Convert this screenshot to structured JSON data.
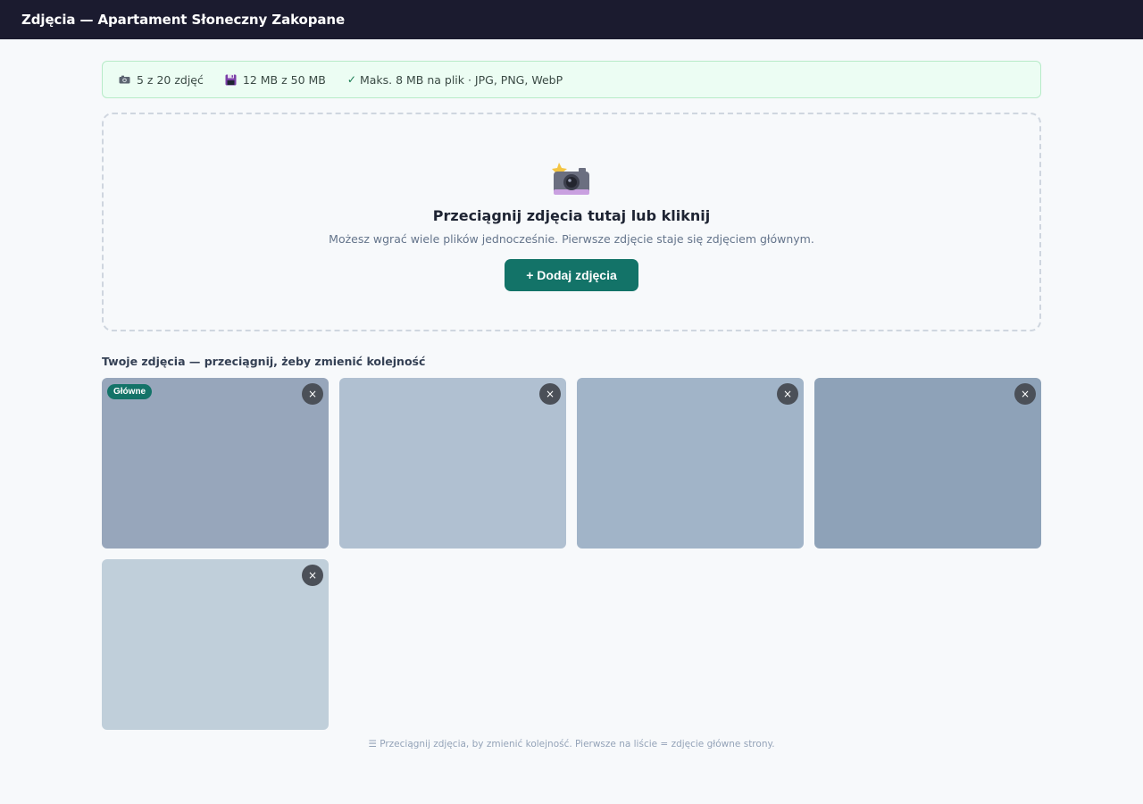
{
  "header": {
    "title": "Zdjęcia — Apartament Słoneczny Zakopane"
  },
  "info_bar": {
    "photos_count": "5 z 20 zdjęć",
    "photos_icon": "camera-icon",
    "storage": "12 MB z 50 MB",
    "storage_icon": "floppy-disk-icon",
    "limits": "Maks. 8 MB na plik · JPG, PNG, WebP",
    "limits_icon": "checkmark-icon",
    "background_color": "#ecfdf3"
  },
  "dropzone": {
    "icon": "camera-with-flash-icon",
    "title": "Przeciągnij zdjęcia tutaj lub kliknij",
    "subtitle": "Możesz wgrać wiele plików jednocześnie. Pierwsze zdjęcie staje się zdjęciem głównym.",
    "button_label": "+ Dodaj zdjęcia"
  },
  "gallery": {
    "label": "Twoje zdjęcia — przeciągnij, żeby zmienić kolejność",
    "main_badge": "Główne",
    "remove_symbol": "×",
    "photos": [
      {
        "color": "#97a6bb",
        "is_main": true
      },
      {
        "color": "#b0c0d1",
        "is_main": false
      },
      {
        "color": "#a1b4c8",
        "is_main": false
      },
      {
        "color": "#8ea2b8",
        "is_main": false
      },
      {
        "color": "#c0cfda",
        "is_main": false
      }
    ]
  },
  "hint": "☰ Przeciągnij zdjęcia, by zmienić kolejność. Pierwsze na liście = zdjęcie główne strony.",
  "colors": {
    "accent": "#137368",
    "topbar": "#1b1b2f"
  }
}
